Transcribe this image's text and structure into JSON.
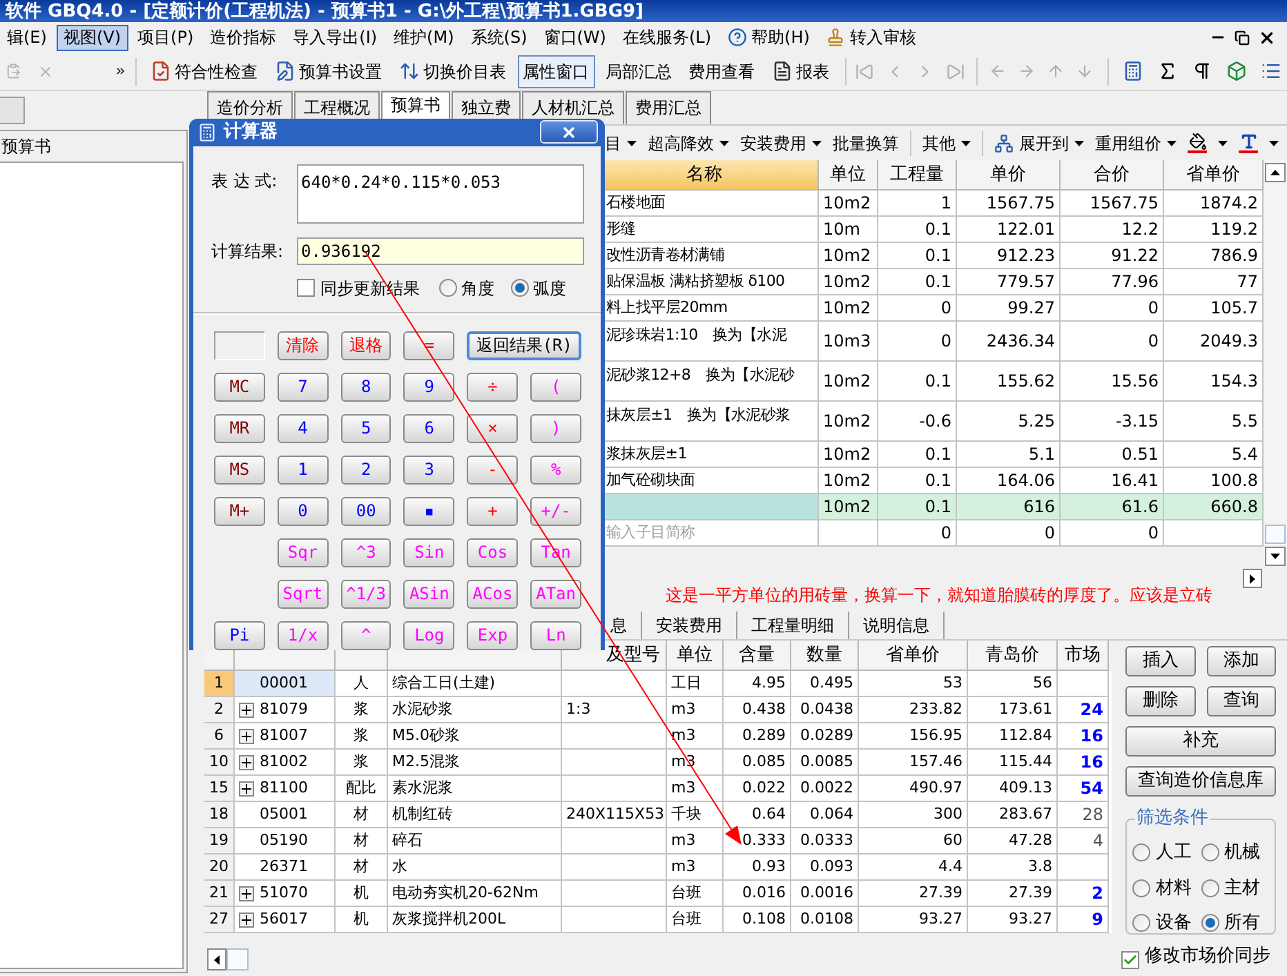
{
  "window": {
    "title": "软件 GBQ4.0 - [定额计价(工程机法) - 预算书1 - G:\\外工程\\预算书1.GBG9]"
  },
  "menu": [
    {
      "label": "辑(E)",
      "selected": false
    },
    {
      "label": "视图(V)",
      "selected": true
    },
    {
      "label": "项目(P)",
      "selected": false
    },
    {
      "label": "造价指标",
      "selected": false
    },
    {
      "label": "导入导出(I)",
      "selected": false
    },
    {
      "label": "维护(M)",
      "selected": false
    },
    {
      "label": "系统(S)",
      "selected": false
    },
    {
      "label": "窗口(W)",
      "selected": false
    },
    {
      "label": "在线服务(L)",
      "selected": false
    },
    {
      "label": "帮助(H)",
      "selected": false
    },
    {
      "label": "转入审核",
      "selected": false
    }
  ],
  "toolbar": [
    {
      "label": "符合性检查",
      "pressed": false
    },
    {
      "label": "预算书设置",
      "pressed": false
    },
    {
      "label": "切换价目表",
      "pressed": false
    },
    {
      "label": "属性窗口",
      "pressed": true
    },
    {
      "label": "局部汇总",
      "pressed": false
    },
    {
      "label": "费用查看",
      "pressed": false
    },
    {
      "label": "报表",
      "pressed": false
    }
  ],
  "left_panel": {
    "title": "预算书"
  },
  "tabs": [
    {
      "label": "造价分析",
      "selected": false
    },
    {
      "label": "工程概况",
      "selected": false
    },
    {
      "label": "预算书",
      "selected": true
    },
    {
      "label": "独立费",
      "selected": false
    },
    {
      "label": "人材机汇总",
      "selected": false
    },
    {
      "label": "费用汇总",
      "selected": false
    }
  ],
  "sub_toolbar": [
    {
      "label": "目",
      "dropdown": true
    },
    {
      "label": "超高降效",
      "dropdown": true
    },
    {
      "label": "安装费用",
      "dropdown": true
    },
    {
      "label": "批量换算",
      "dropdown": false
    },
    {
      "label": "其他",
      "dropdown": true
    },
    {
      "label": "展开到",
      "dropdown": true
    },
    {
      "label": "重用组价",
      "dropdown": true
    }
  ],
  "upper_table": {
    "columns": [
      "名称",
      "单位",
      "工程量",
      "单价",
      "合价",
      "省单价"
    ],
    "rows": [
      {
        "kind": "item",
        "selected": false,
        "wrapped": false,
        "cells": [
          "石楼地面",
          "10m2",
          "1",
          "1567.75",
          "1567.75",
          "1874.2"
        ]
      },
      {
        "kind": "item",
        "selected": false,
        "wrapped": false,
        "cells": [
          "形缝",
          "10m",
          "0.1",
          "122.01",
          "12.2",
          "119.2"
        ]
      },
      {
        "kind": "item",
        "selected": false,
        "wrapped": false,
        "cells": [
          "改性沥青卷材满铺",
          "10m2",
          "0.1",
          "912.23",
          "91.22",
          "786.9"
        ]
      },
      {
        "kind": "item",
        "selected": false,
        "wrapped": false,
        "cells": [
          "贴保温板 满粘挤塑板 δ100",
          "10m2",
          "0.1",
          "779.57",
          "77.96",
          "77"
        ]
      },
      {
        "kind": "item",
        "selected": false,
        "wrapped": false,
        "cells": [
          "料上找平层20mm",
          "10m2",
          "0",
          "99.27",
          "0",
          "105.7"
        ]
      },
      {
        "kind": "item",
        "selected": false,
        "wrapped": true,
        "cells": [
          "泥珍珠岩1:10　换为【水泥",
          "10m3",
          "0",
          "2436.34",
          "0",
          "2049.3"
        ]
      },
      {
        "kind": "item",
        "selected": false,
        "wrapped": true,
        "cells": [
          "泥砂浆12+8　换为【水泥砂",
          "10m2",
          "0.1",
          "155.62",
          "15.56",
          "154.3"
        ]
      },
      {
        "kind": "item",
        "selected": false,
        "wrapped": true,
        "cells": [
          "抹灰层±1　换为【水泥砂浆",
          "10m2",
          "-0.6",
          "5.25",
          "-3.15",
          "5.5"
        ]
      },
      {
        "kind": "item",
        "selected": false,
        "wrapped": false,
        "cells": [
          "浆抹灰层±1",
          "10m2",
          "0.1",
          "5.1",
          "0.51",
          "5.4"
        ]
      },
      {
        "kind": "item",
        "selected": false,
        "wrapped": false,
        "cells": [
          "加气砼砌块面",
          "10m2",
          "0.1",
          "164.06",
          "16.41",
          "100.8"
        ]
      },
      {
        "kind": "item",
        "selected": true,
        "wrapped": false,
        "cells": [
          "",
          "10m2",
          "0.1",
          "616",
          "61.6",
          "660.8"
        ]
      },
      {
        "kind": "input",
        "selected": false,
        "wrapped": false,
        "placeholder": "输入子目简称",
        "cells": [
          "",
          "",
          "0",
          "0",
          "0",
          ""
        ]
      }
    ]
  },
  "annotation": {
    "text": "这是一平方单位的用砖量，换算一下，就知道胎膜砖的厚度了。应该是立砖"
  },
  "lower_tabs": [
    {
      "label": "息",
      "selected": false
    },
    {
      "label": "安装费用",
      "selected": false
    },
    {
      "label": "工程量明细",
      "selected": false
    },
    {
      "label": "说明信息",
      "selected": false
    }
  ],
  "lower_table": {
    "columns": [
      "及型号",
      "单位",
      "含量",
      "数量",
      "省单价",
      "青岛价",
      "市场"
    ],
    "rows": [
      {
        "no": "1",
        "code": "00001",
        "expandable": false,
        "type": "人",
        "name": "综合工日(土建)",
        "unit": "工日",
        "content": "4.95",
        "qty": "0.495",
        "prov_price": "53",
        "qd_price": "56",
        "selected": true
      },
      {
        "no": "2",
        "code": "81079",
        "expandable": true,
        "type": "浆",
        "name": "水泥砂浆",
        "spec": "1:3",
        "unit": "m3",
        "content": "0.438",
        "qty": "0.0438",
        "prov_price": "233.82",
        "qd_price": "173.61",
        "market": "24",
        "adjusted": true,
        "selected": false
      },
      {
        "no": "6",
        "code": "81007",
        "expandable": true,
        "type": "浆",
        "name": "M5.0砂浆",
        "unit": "m3",
        "content": "0.289",
        "qty": "0.0289",
        "prov_price": "156.95",
        "qd_price": "112.84",
        "market": "16",
        "adjusted": true,
        "selected": false
      },
      {
        "no": "10",
        "code": "81002",
        "expandable": true,
        "type": "浆",
        "name": "M2.5混浆",
        "unit": "m3",
        "content": "0.085",
        "qty": "0.0085",
        "prov_price": "157.46",
        "qd_price": "115.44",
        "market": "16",
        "adjusted": true,
        "selected": false
      },
      {
        "no": "15",
        "code": "81100",
        "expandable": true,
        "type": "配比",
        "name": "素水泥浆",
        "unit": "m3",
        "content": "0.022",
        "qty": "0.0022",
        "prov_price": "490.97",
        "qd_price": "409.13",
        "market": "54",
        "adjusted": true,
        "selected": false
      },
      {
        "no": "18",
        "code": "05001",
        "expandable": false,
        "type": "材",
        "name": "机制红砖",
        "spec": "240X115X53",
        "unit": "千块",
        "content": "0.64",
        "qty": "0.064",
        "prov_price": "300",
        "qd_price": "283.67",
        "market": "28",
        "adjusted": false,
        "selected": false
      },
      {
        "no": "19",
        "code": "05190",
        "expandable": false,
        "type": "材",
        "name": "碎石",
        "unit": "m3",
        "content": "0.333",
        "qty": "0.0333",
        "prov_price": "60",
        "qd_price": "47.28",
        "market": "4",
        "adjusted": false,
        "selected": false
      },
      {
        "no": "20",
        "code": "26371",
        "expandable": false,
        "type": "材",
        "name": "水",
        "unit": "m3",
        "content": "0.93",
        "qty": "0.093",
        "prov_price": "4.4",
        "qd_price": "3.8",
        "selected": false
      },
      {
        "no": "21",
        "code": "51070",
        "expandable": true,
        "type": "机",
        "name": "电动夯实机20-62Nm",
        "unit": "台班",
        "content": "0.016",
        "qty": "0.0016",
        "prov_price": "27.39",
        "qd_price": "27.39",
        "market": "2",
        "adjusted": true,
        "selected": false
      },
      {
        "no": "27",
        "code": "56017",
        "expandable": true,
        "type": "机",
        "name": "灰浆搅拌机200L",
        "unit": "台班",
        "content": "0.108",
        "qty": "0.0108",
        "prov_price": "93.27",
        "qd_price": "93.27",
        "market": "9",
        "adjusted": true,
        "selected": false
      }
    ]
  },
  "side_buttons": [
    "插入",
    "添加",
    "删除",
    "查询",
    "补充",
    "查询造价信息库"
  ],
  "filter": {
    "title": "筛选条件",
    "options": [
      {
        "label": "人工",
        "selected": false
      },
      {
        "label": "机械",
        "selected": false
      },
      {
        "label": "材料",
        "selected": false
      },
      {
        "label": "主材",
        "selected": false
      },
      {
        "label": "设备",
        "selected": false
      },
      {
        "label": "所有",
        "selected": true
      }
    ]
  },
  "sync_market": {
    "label": "修改市场价同步",
    "checked": true
  },
  "calculator": {
    "title": "计算器",
    "expression_label": "表 达 式:",
    "expression": "640*0.24*0.115*0.053",
    "result_label": "计算结果:",
    "result": "0.936192",
    "sync": {
      "label": "同步更新结果",
      "checked": false
    },
    "angle_modes": [
      {
        "label": "角度",
        "selected": false
      },
      {
        "label": "弧度",
        "selected": true
      }
    ],
    "keys": [
      [
        {
          "label": "清除",
          "kind": "action"
        },
        {
          "label": "退格",
          "kind": "action"
        },
        {
          "label": "=",
          "kind": "operator"
        },
        {
          "label": "返回结果(R)",
          "kind": "return"
        }
      ],
      [
        {
          "label": "MC",
          "kind": "memory"
        },
        {
          "label": "7",
          "kind": "digit"
        },
        {
          "label": "8",
          "kind": "digit"
        },
        {
          "label": "9",
          "kind": "digit"
        },
        {
          "label": "÷",
          "kind": "operator"
        },
        {
          "label": "(",
          "kind": "function"
        }
      ],
      [
        {
          "label": "MR",
          "kind": "memory"
        },
        {
          "label": "4",
          "kind": "digit"
        },
        {
          "label": "5",
          "kind": "digit"
        },
        {
          "label": "6",
          "kind": "digit"
        },
        {
          "label": "×",
          "kind": "operator"
        },
        {
          "label": ")",
          "kind": "function"
        }
      ],
      [
        {
          "label": "MS",
          "kind": "memory"
        },
        {
          "label": "1",
          "kind": "digit"
        },
        {
          "label": "2",
          "kind": "digit"
        },
        {
          "label": "3",
          "kind": "digit"
        },
        {
          "label": "-",
          "kind": "operator"
        },
        {
          "label": "%",
          "kind": "function"
        }
      ],
      [
        {
          "label": "M+",
          "kind": "memory"
        },
        {
          "label": "0",
          "kind": "digit"
        },
        {
          "label": "00",
          "kind": "digit"
        },
        {
          "label": "▪",
          "kind": "digit"
        },
        {
          "label": "+",
          "kind": "operator"
        },
        {
          "label": "+/-",
          "kind": "function"
        }
      ],
      [
        {
          "label": "Sqr",
          "kind": "function"
        },
        {
          "label": "^3",
          "kind": "function"
        },
        {
          "label": "Sin",
          "kind": "function"
        },
        {
          "label": "Cos",
          "kind": "function"
        },
        {
          "label": "Tan",
          "kind": "function"
        }
      ],
      [
        {
          "label": "Sqrt",
          "kind": "function"
        },
        {
          "label": "^1/3",
          "kind": "function"
        },
        {
          "label": "ASin",
          "kind": "function"
        },
        {
          "label": "ACos",
          "kind": "function"
        },
        {
          "label": "ATan",
          "kind": "function"
        }
      ],
      [
        {
          "label": "Pi",
          "kind": "constant"
        },
        {
          "label": "1/x",
          "kind": "function"
        },
        {
          "label": "^",
          "kind": "function"
        },
        {
          "label": "Log",
          "kind": "function"
        },
        {
          "label": "Exp",
          "kind": "function"
        },
        {
          "label": "Ln",
          "kind": "function"
        }
      ]
    ]
  }
}
